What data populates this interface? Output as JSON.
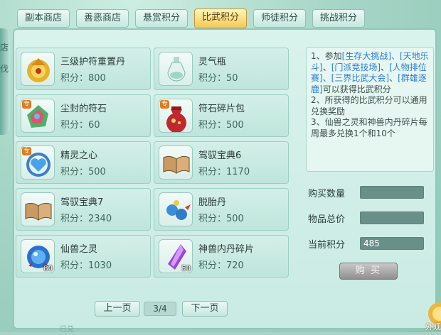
{
  "tabs": [
    {
      "label": "副本商店",
      "active": false
    },
    {
      "label": "善恶商店",
      "active": false
    },
    {
      "label": "悬赏积分",
      "active": false
    },
    {
      "label": "比武积分",
      "active": true
    },
    {
      "label": "师徒积分",
      "active": false
    },
    {
      "label": "挑战积分",
      "active": false
    }
  ],
  "side_edge": [
    "店",
    "伐"
  ],
  "items": [
    {
      "name": "三级护符重置丹",
      "price": "积分：800",
      "icon": "golden-lotus-pill-icon",
      "badge": "",
      "count": ""
    },
    {
      "name": "灵气瓶",
      "price": "积分：50",
      "icon": "spirit-bottle-icon",
      "badge": "",
      "count": ""
    },
    {
      "name": "尘封的符石",
      "price": "积分：60",
      "icon": "sealed-runestone-icon",
      "badge": "专",
      "count": ""
    },
    {
      "name": "符石碎片包",
      "price": "积分：500",
      "icon": "runestone-fragment-bag-icon",
      "badge": "专",
      "count": ""
    },
    {
      "name": "精灵之心",
      "price": "积分：500",
      "icon": "spirit-heart-icon",
      "badge": "专",
      "count": ""
    },
    {
      "name": "驾驭宝典6",
      "price": "积分：1170",
      "icon": "open-book-icon",
      "badge": "",
      "count": ""
    },
    {
      "name": "驾驭宝典7",
      "price": "积分：2340",
      "icon": "open-book-icon",
      "badge": "",
      "count": ""
    },
    {
      "name": "脱胎丹",
      "price": "积分：500",
      "icon": "blue-birds-pill-icon",
      "badge": "",
      "count": ""
    },
    {
      "name": "仙兽之灵",
      "price": "积分：1030",
      "icon": "beast-spirit-orb-icon",
      "badge": "",
      "count": "80"
    },
    {
      "name": "神兽内丹碎片",
      "price": "积分：720",
      "icon": "purple-crystal-icon",
      "badge": "",
      "count": "50"
    }
  ],
  "info": {
    "l1a": "1、参加",
    "l1b": "[生存大挑战]、[天地乐斗]",
    "l1c": "、",
    "l1d": "[门派竞技场]",
    "l1e": "、",
    "l1f": "[人物排位赛]、[三界比武大会]",
    "l1g": "、",
    "l1h": "[群雄逐鹿]",
    "l1i": "可以获得比武积分",
    "l2": "2、所获得的比武积分可以通用兑换奖励",
    "l3": "3、仙兽之灵和神兽内丹碎片每周最多兑换1个和10个"
  },
  "form": {
    "qty_label": "购买数量",
    "qty_value": "",
    "total_label": "物品总价",
    "total_value": "",
    "points_label": "当前积分",
    "points_value": "485",
    "buy_label": "购 买"
  },
  "pager": {
    "prev": "上一页",
    "page": "3/4",
    "next": "下一页"
  },
  "corner_label": "外观",
  "bottom_text": "已兑",
  "colors": {
    "active_tab": "#f4c957",
    "highlight": "#2a7bd6",
    "field": "#6a8f89"
  }
}
